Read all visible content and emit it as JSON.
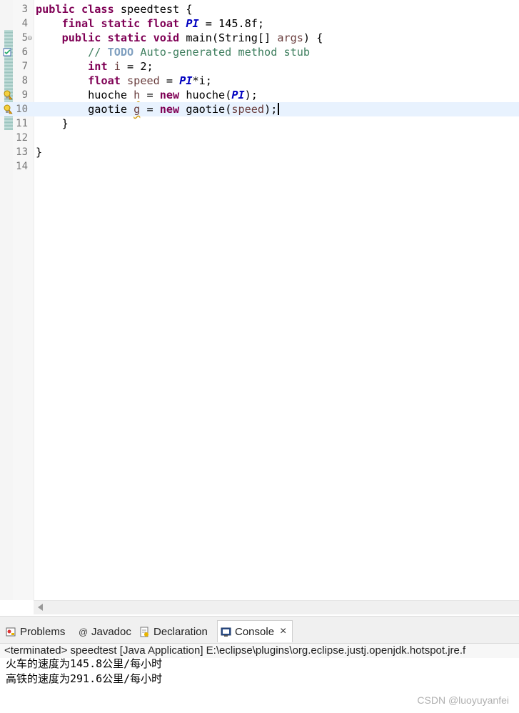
{
  "editor": {
    "lines": [
      {
        "num": "3",
        "tokens": [
          {
            "t": "public class",
            "c": "kw"
          },
          {
            "t": " speedtest {",
            "c": ""
          }
        ]
      },
      {
        "num": "4",
        "tokens": [
          {
            "t": "    ",
            "c": ""
          },
          {
            "t": "final static float",
            "c": "kw"
          },
          {
            "t": " ",
            "c": ""
          },
          {
            "t": "PI",
            "c": "const"
          },
          {
            "t": " = 145.8f;",
            "c": ""
          }
        ]
      },
      {
        "num": "5",
        "fold": "⊖",
        "tokens": [
          {
            "t": "    ",
            "c": ""
          },
          {
            "t": "public static void",
            "c": "kw"
          },
          {
            "t": " main(String[] ",
            "c": ""
          },
          {
            "t": "args",
            "c": "var"
          },
          {
            "t": ") {",
            "c": ""
          }
        ]
      },
      {
        "num": "6",
        "tokens": [
          {
            "t": "        ",
            "c": ""
          },
          {
            "t": "// ",
            "c": "cmt"
          },
          {
            "t": "TODO",
            "c": "todo"
          },
          {
            "t": " Auto-generated method stub",
            "c": "cmt"
          }
        ]
      },
      {
        "num": "7",
        "tokens": [
          {
            "t": "        ",
            "c": ""
          },
          {
            "t": "int",
            "c": "kw"
          },
          {
            "t": " ",
            "c": ""
          },
          {
            "t": "i",
            "c": "var"
          },
          {
            "t": " = 2;",
            "c": ""
          }
        ]
      },
      {
        "num": "8",
        "tokens": [
          {
            "t": "        ",
            "c": ""
          },
          {
            "t": "float",
            "c": "kw"
          },
          {
            "t": " ",
            "c": ""
          },
          {
            "t": "speed",
            "c": "var"
          },
          {
            "t": " = ",
            "c": ""
          },
          {
            "t": "PI",
            "c": "const"
          },
          {
            "t": "*i;",
            "c": ""
          }
        ]
      },
      {
        "num": "9",
        "tokens": [
          {
            "t": "        huoche ",
            "c": ""
          },
          {
            "t": "h",
            "c": "var warn"
          },
          {
            "t": " = ",
            "c": ""
          },
          {
            "t": "new",
            "c": "kw"
          },
          {
            "t": " huoche(",
            "c": ""
          },
          {
            "t": "PI",
            "c": "const"
          },
          {
            "t": ");",
            "c": ""
          }
        ]
      },
      {
        "num": "10",
        "current": true,
        "tokens": [
          {
            "t": "        gaotie ",
            "c": ""
          },
          {
            "t": "g",
            "c": "var warn"
          },
          {
            "t": " = ",
            "c": ""
          },
          {
            "t": "new",
            "c": "kw"
          },
          {
            "t": " gaotie(",
            "c": ""
          },
          {
            "t": "speed",
            "c": "var"
          },
          {
            "t": ");",
            "c": ""
          }
        ]
      },
      {
        "num": "11",
        "tokens": [
          {
            "t": "    }",
            "c": ""
          }
        ]
      },
      {
        "num": "12",
        "tokens": []
      },
      {
        "num": "13",
        "tokens": [
          {
            "t": "}",
            "c": ""
          }
        ]
      },
      {
        "num": "14",
        "tokens": []
      }
    ]
  },
  "panel": {
    "tabs": {
      "problems": "Problems",
      "javadoc": "Javadoc",
      "declaration": "Declaration",
      "console": "Console"
    },
    "close_glyph": "×",
    "terminated": "<terminated> speedtest [Java Application] E:\\eclipse\\plugins\\org.eclipse.justj.openjdk.hotspot.jre.f",
    "output": [
      "火车的速度为145.8公里/每小时",
      "高铁的速度为291.6公里/每小时"
    ]
  },
  "watermark": "CSDN @luoyuyanfei",
  "colors": {
    "keyword": "#7f0055",
    "constant": "#0000c0",
    "comment": "#3f7f5f",
    "current_line": "#e8f2fe"
  }
}
